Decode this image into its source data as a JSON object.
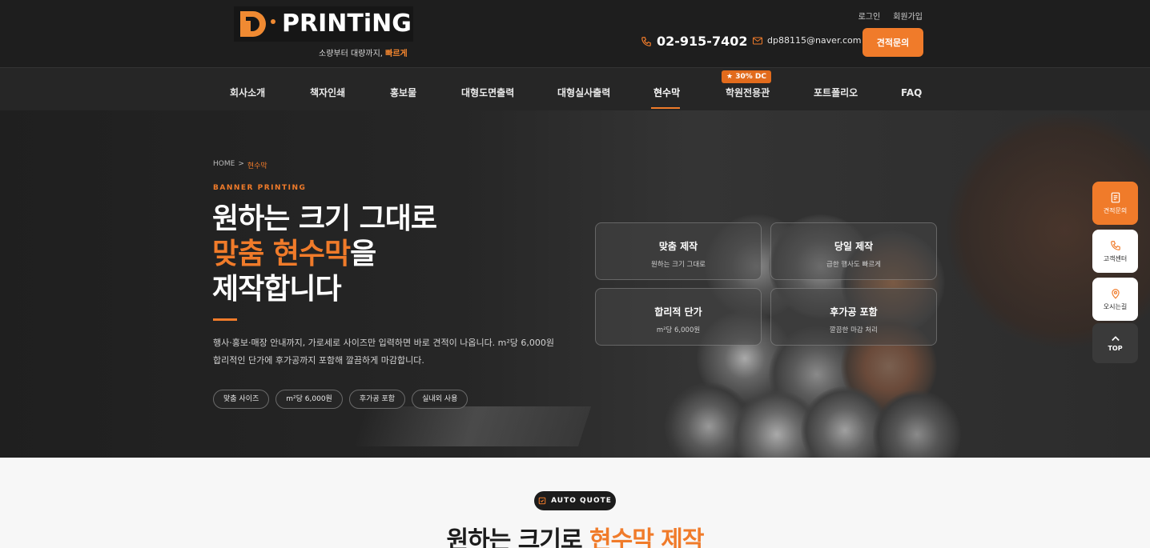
{
  "header": {
    "logo_text": "PRINTiNG",
    "logo_alt": "D·PRINTiNG",
    "tagline_prefix": "소량부터 대량까지,",
    "tagline_highlight": "빠르게",
    "util_links": [
      "로그인",
      "회원가입"
    ],
    "phone": "02-915-7402",
    "email": "dp88115@naver.com",
    "quote_button": "견적문의",
    "accent_color": "#f07b2a"
  },
  "nav": {
    "items": [
      "회사소개",
      "책자인쇄",
      "홍보물",
      "대형도면출력",
      "대형실사출력",
      "현수막",
      "학원전용관",
      "포트폴리오",
      "FAQ"
    ],
    "active": "현수막",
    "badge": "★ 30% DC"
  },
  "hero": {
    "breadcrumb_home": "HOME",
    "breadcrumb_sep": ">",
    "breadcrumb_current": "현수막",
    "eyebrow": "BANNER PRINTING",
    "title_line1": "원하는 크기 그대로",
    "title_line2_highlight": "맞춤 현수막",
    "title_line2_rest": "을",
    "title_line3": "제작합니다",
    "desc_line1": "행사·홍보·매장 안내까지, 가로세로 사이즈만 입력하면 바로 견적이 나옵니다. m²당 6,000원",
    "desc_line2": "합리적인 단가에 후가공까지 포함해 깔끔하게 마감합니다.",
    "chips": [
      "맞춤 사이즈",
      "m²당 6,000원",
      "후가공 포함",
      "실내외 사용"
    ],
    "cards": [
      {
        "title": "맞춤 제작",
        "sub": "원하는 크기 그대로"
      },
      {
        "title": "당일 제작",
        "sub": "급한 행사도 빠르게"
      },
      {
        "title": "합리적 단가",
        "sub": "m²당 6,000원"
      },
      {
        "title": "후가공 포함",
        "sub": "깔끔한 마감 처리"
      }
    ]
  },
  "float": {
    "quote": "견적문의",
    "call": "고객센터",
    "map": "오시는길",
    "top": "TOP"
  },
  "section": {
    "pill": "AUTO QUOTE",
    "title_prefix": "원하는 크기로",
    "title_highlight": "현수막 제작"
  }
}
